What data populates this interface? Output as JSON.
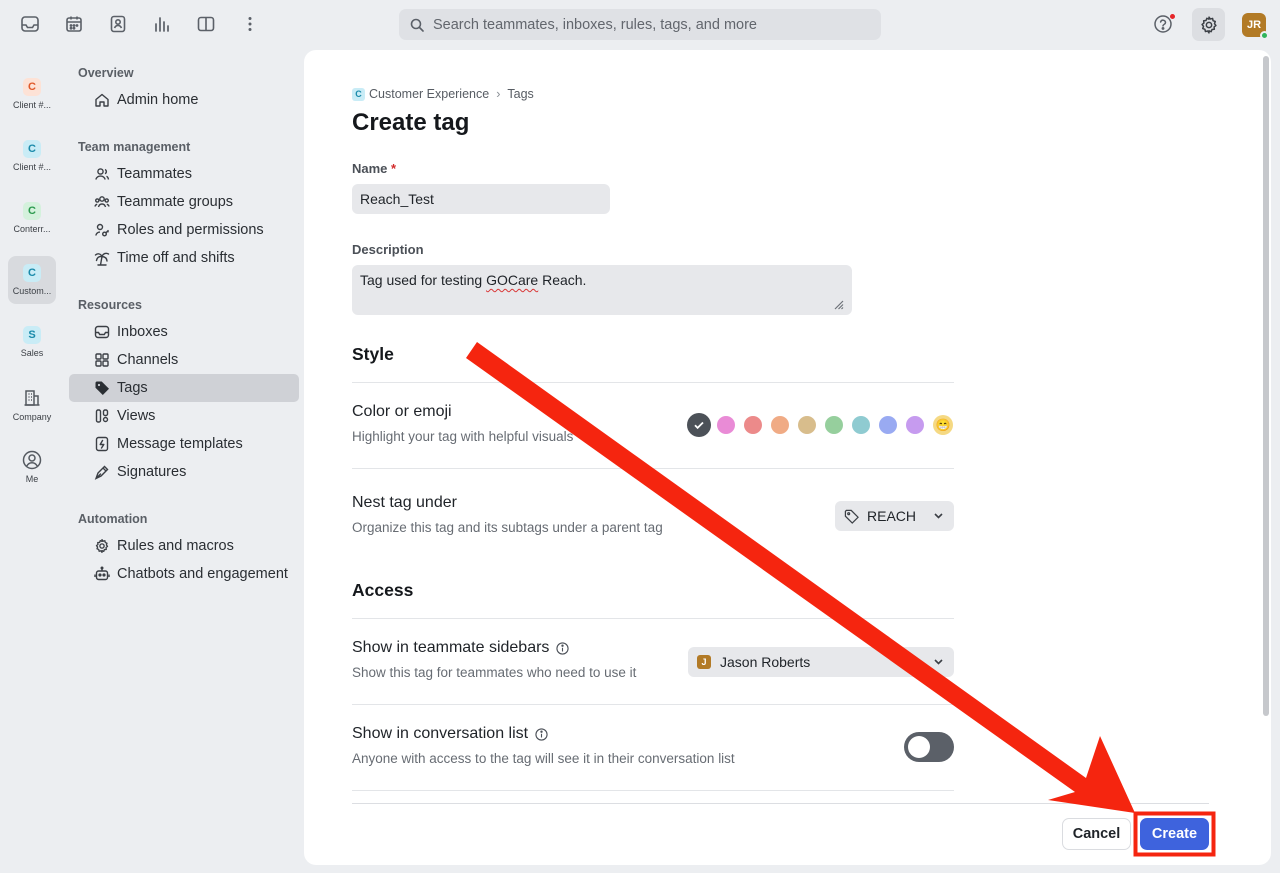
{
  "topbar": {
    "search_placeholder": "Search teammates, inboxes, rules, tags, and more",
    "avatar_initials": "JR",
    "icons": [
      "inbox-icon",
      "calendar-icon",
      "contacts-icon",
      "analytics-icon",
      "split-view-icon",
      "more-icon",
      "help-icon",
      "settings-icon"
    ]
  },
  "rail": {
    "items": [
      {
        "badge": "C",
        "label": "Client #...",
        "badge_bg": "#fde2d6",
        "badge_fg": "#e0592a"
      },
      {
        "badge": "C",
        "label": "Client #...",
        "badge_bg": "#c9ecf6",
        "badge_fg": "#1a8aaa"
      },
      {
        "badge": "C",
        "label": "Conterr...",
        "badge_bg": "#d4f1dc",
        "badge_fg": "#2c9a4e"
      },
      {
        "badge": "C",
        "label": "Custom...",
        "badge_bg": "#c9ecf6",
        "badge_fg": "#1a8aaa"
      },
      {
        "badge": "S",
        "label": "Sales",
        "badge_bg": "#c9ecf6",
        "badge_fg": "#1a8aaa"
      }
    ],
    "company_label": "Company",
    "me_label": "Me"
  },
  "nav": {
    "overview": {
      "heading": "Overview",
      "items": [
        "Admin home"
      ]
    },
    "team": {
      "heading": "Team management",
      "items": [
        "Teammates",
        "Teammate groups",
        "Roles and permissions",
        "Time off and shifts"
      ]
    },
    "resources": {
      "heading": "Resources",
      "items": [
        "Inboxes",
        "Channels",
        "Tags",
        "Views",
        "Message templates",
        "Signatures"
      ]
    },
    "automation": {
      "heading": "Automation",
      "items": [
        "Rules and macros",
        "Chatbots and engagement"
      ]
    }
  },
  "main": {
    "breadcrumb": {
      "badge": "C",
      "parent": "Customer Experience",
      "sep": "›",
      "current": "Tags"
    },
    "title": "Create tag",
    "name_label": "Name",
    "required_mark": "*",
    "name_value": "Reach_Test",
    "description_label": "Description",
    "description_pre": "Tag used for testing ",
    "description_err": "GOCare",
    "description_post": " Reach.",
    "style_heading": "Style",
    "color_title": "Color or emoji",
    "color_sub": "Highlight your tag with helpful visuals",
    "colors": [
      "#4c5158",
      "#e98bd6",
      "#ec8a8a",
      "#f0ab85",
      "#d8bd8c",
      "#96cf9d",
      "#8fcbd1",
      "#99aaf2",
      "#c69bef"
    ],
    "emoji": "😁",
    "nest_title": "Nest tag under",
    "nest_sub": "Organize this tag and its subtags under a parent tag",
    "nest_value": "REACH",
    "access_heading": "Access",
    "sidebars_title": "Show in teammate sidebars",
    "sidebars_sub": "Show this tag for teammates who need to use it",
    "sidebars_value": "Jason Roberts",
    "sidebars_avatar": "J",
    "convlist_title": "Show in conversation list",
    "convlist_sub": "Anyone with access to the tag will see it in their conversation list",
    "convlist_enabled": false,
    "cancel_label": "Cancel",
    "create_label": "Create"
  },
  "annotation": {
    "arrow_color": "#f5250f",
    "highlight_color": "#f5250f"
  }
}
